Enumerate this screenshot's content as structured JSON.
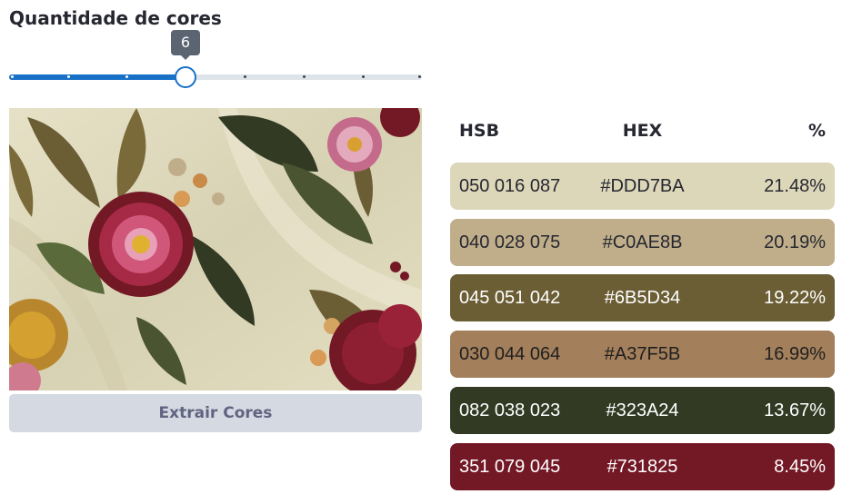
{
  "slider": {
    "label": "Quantidade de cores",
    "value": "6",
    "min": 1,
    "max": 8,
    "position": 0.43
  },
  "button": {
    "label": "Extrair Cores"
  },
  "table": {
    "headers": {
      "hsb": "HSB",
      "hex": "HEX",
      "pct": "%"
    },
    "rows": [
      {
        "hsb": "050 016 087",
        "hex": "#DDD7BA",
        "pct": "21.48%",
        "bg": "#DDD7BA",
        "fg": "#262730"
      },
      {
        "hsb": "040 028 075",
        "hex": "#C0AE8B",
        "pct": "20.19%",
        "bg": "#C0AE8B",
        "fg": "#262730"
      },
      {
        "hsb": "045 051 042",
        "hex": "#6B5D34",
        "pct": "19.22%",
        "bg": "#6B5D34",
        "fg": "#ffffff"
      },
      {
        "hsb": "030 044 064",
        "hex": "#A37F5B",
        "pct": "16.99%",
        "bg": "#A37F5B",
        "fg": "#1f1f1f"
      },
      {
        "hsb": "082 038 023",
        "hex": "#323A24",
        "pct": "13.67%",
        "bg": "#323A24",
        "fg": "#ffffff"
      },
      {
        "hsb": "351 079 045",
        "hex": "#731825",
        "pct": "8.45%",
        "bg": "#731825",
        "fg": "#ffffff"
      }
    ]
  },
  "colors": {
    "accent": "#1871c7",
    "track": "#dde4ea",
    "button_bg": "#d4d9e2",
    "button_text": "#5f6480"
  }
}
